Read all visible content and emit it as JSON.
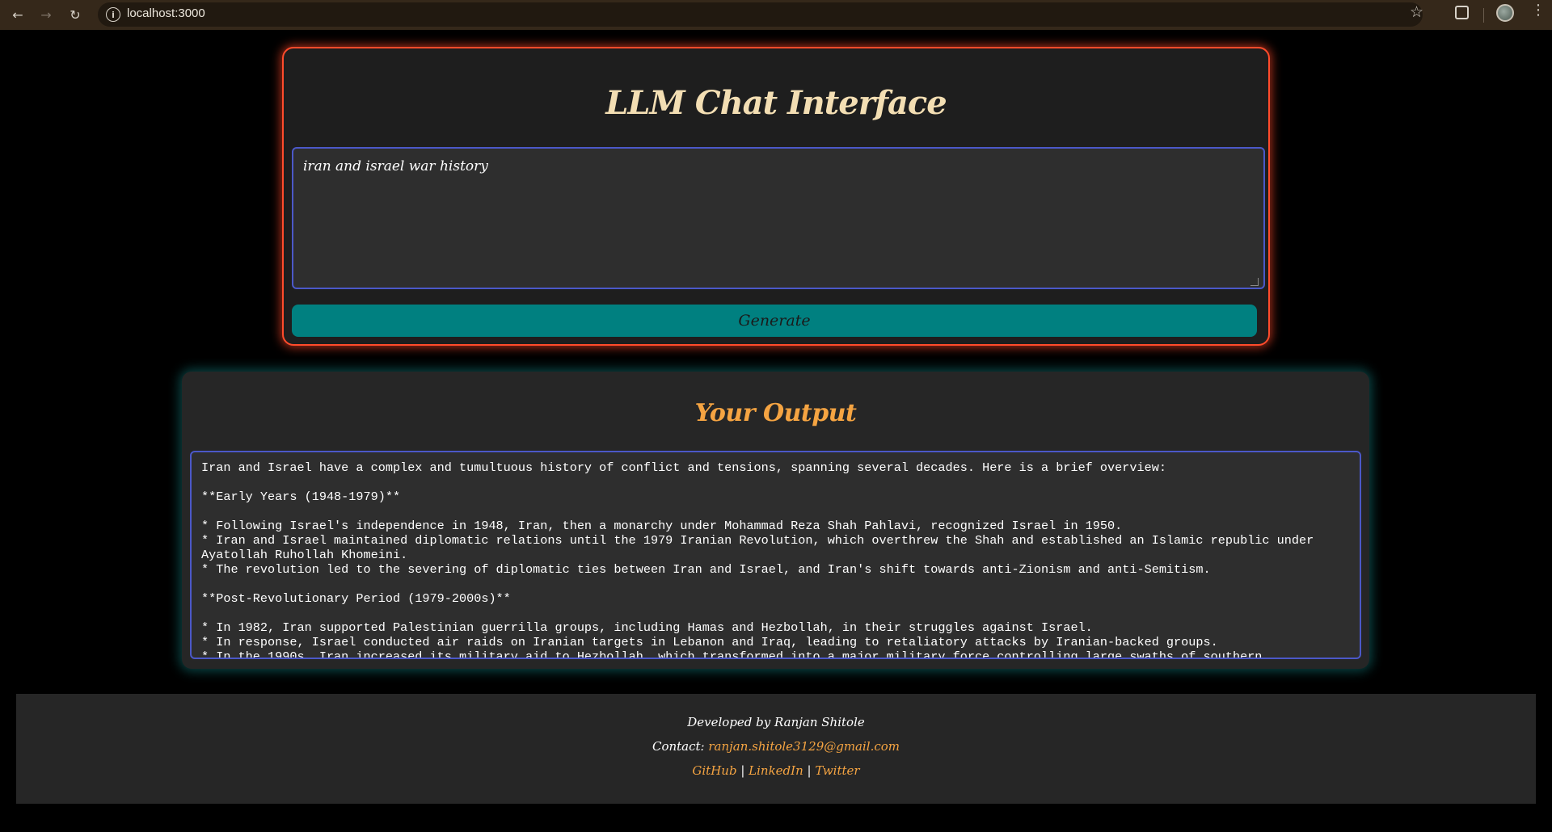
{
  "browser": {
    "url": "localhost:3000"
  },
  "chat": {
    "title": "LLM Chat Interface",
    "prompt_value": "iran and israel war history",
    "generate_label": "Generate"
  },
  "output": {
    "title": "Your Output",
    "text": "Iran and Israel have a complex and tumultuous history of conflict and tensions, spanning several decades. Here is a brief overview:\n\n**Early Years (1948-1979)**\n\n* Following Israel's independence in 1948, Iran, then a monarchy under Mohammad Reza Shah Pahlavi, recognized Israel in 1950.\n* Iran and Israel maintained diplomatic relations until the 1979 Iranian Revolution, which overthrew the Shah and established an Islamic republic under Ayatollah Ruhollah Khomeini.\n* The revolution led to the severing of diplomatic ties between Iran and Israel, and Iran's shift towards anti-Zionism and anti-Semitism.\n\n**Post-Revolutionary Period (1979-2000s)**\n\n* In 1982, Iran supported Palestinian guerrilla groups, including Hamas and Hezbollah, in their struggles against Israel.\n* In response, Israel conducted air raids on Iranian targets in Lebanon and Iraq, leading to retaliatory attacks by Iranian-backed groups.\n* In the 1990s, Iran increased its military aid to Hezbollah, which transformed into a major military force controlling large swaths of southern"
  },
  "footer": {
    "developed_by": "Developed by Ranjan Shitole",
    "contact_label": "Contact:",
    "contact_email": "ranjan.shitole3129@gmail.com",
    "links": [
      "GitHub",
      "LinkedIn",
      "Twitter"
    ],
    "separator": "|"
  },
  "colors": {
    "chat_border": "#ff4b2b",
    "generate_button": "#008080",
    "output_title": "#f5a442",
    "input_border": "#4b58c8"
  }
}
